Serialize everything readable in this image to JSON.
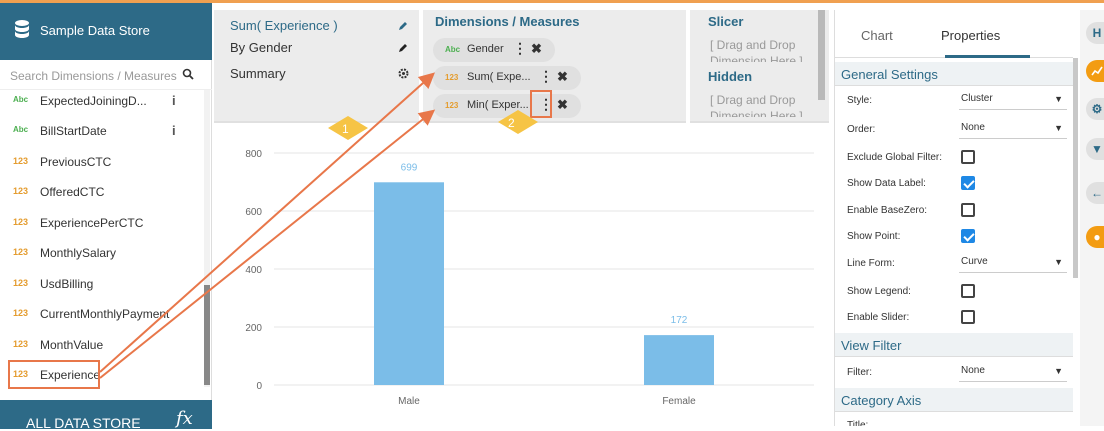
{
  "app": {
    "title": "Sample Data Store"
  },
  "search": {
    "placeholder": "Search Dimensions / Measures"
  },
  "fields": [
    {
      "type": "Abc",
      "name": "ExpectedJoiningD...",
      "info": "i"
    },
    {
      "type": "Abc",
      "name": "BillStartDate",
      "info": "i"
    },
    {
      "type": "123",
      "name": "PreviousCTC"
    },
    {
      "type": "123",
      "name": "OfferedCTC"
    },
    {
      "type": "123",
      "name": "ExperiencePerCTC"
    },
    {
      "type": "123",
      "name": "MonthlySalary"
    },
    {
      "type": "123",
      "name": "UsdBilling"
    },
    {
      "type": "123",
      "name": "CurrentMonthlyPayment"
    },
    {
      "type": "123",
      "name": "MonthValue"
    },
    {
      "type": "123",
      "name": "Experience"
    }
  ],
  "footer": {
    "label": "ALL DATA STORE",
    "fx": "fx"
  },
  "config": {
    "row1": "Sum( Experience )",
    "row2": "By Gender",
    "row3": "Summary",
    "dims_title": "Dimensions / Measures",
    "pills": [
      {
        "type": "Abc",
        "label": "Gender"
      },
      {
        "type": "123",
        "label": "Sum( Expe..."
      },
      {
        "type": "123",
        "label": "Min( Exper..."
      }
    ],
    "slicer_title": "Slicer",
    "slicer_drag1": "[ Drag and Drop",
    "slicer_drag2": "Dimension Here ]",
    "hidden_title": "Hidden",
    "hidden_drag1": "[ Drag and Drop",
    "hidden_drag2": "Dimension Here ]"
  },
  "annotations": {
    "one": "1",
    "two": "2"
  },
  "chart_data": {
    "type": "bar",
    "categories": [
      "Male",
      "Female"
    ],
    "values": [
      699,
      172
    ],
    "data_labels": [
      "699",
      "172"
    ],
    "yticks": [
      0,
      200,
      400,
      600,
      800
    ],
    "ytick_labels": [
      "0",
      "200",
      "400",
      "600",
      "800"
    ],
    "ylim": [
      0,
      800
    ],
    "color": "#7bbde8",
    "grid": true
  },
  "properties": {
    "tabs": [
      "Chart",
      "Properties"
    ],
    "general_title": "General Settings",
    "style_label": "Style:",
    "style_value": "Cluster",
    "order_label": "Order:",
    "order_value": "None",
    "exclude_label": "Exclude Global Filter:",
    "showdata_label": "Show Data Label:",
    "basezero_label": "Enable BaseZero:",
    "showpoint_label": "Show Point:",
    "lineform_label": "Line Form:",
    "lineform_value": "Curve",
    "legend_label": "Show Legend:",
    "slider_label": "Enable Slider:",
    "viewfilter_title": "View Filter",
    "filter_label": "Filter:",
    "filter_value": "None",
    "category_title": "Category Axis",
    "title_label": "Title:"
  },
  "strip_icons": [
    "h-icon",
    "chart-icon",
    "gears-icon",
    "filter-icon",
    "back-arrow-icon",
    "bulb-icon"
  ]
}
